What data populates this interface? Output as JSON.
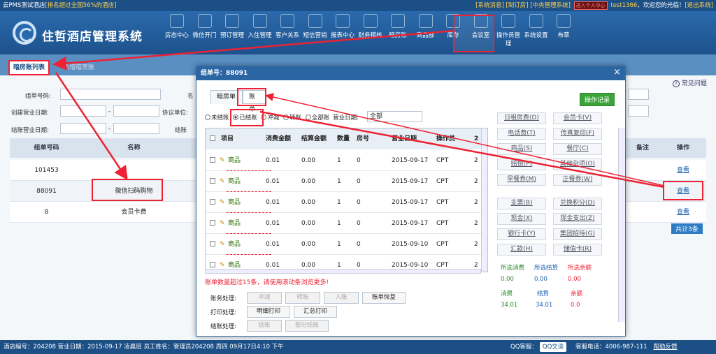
{
  "topbar": {
    "left_name": "云PMS测试酒店",
    "left_rank": "[排名超过全国56%的酒店]",
    "links": "[系统消息] [制订房] [中央管理系统]",
    "badge": "进入个人中心",
    "user": "test1366",
    "greeting": "，欢迎您的光临！",
    "logout": "[退出系统]"
  },
  "brand": {
    "name": "住哲酒店管理系统"
  },
  "nav": [
    {
      "label": "房态中心",
      "icon": "home-icon"
    },
    {
      "label": "微信开门",
      "icon": "door-icon"
    },
    {
      "label": "预订管理",
      "icon": "booking-icon"
    },
    {
      "label": "入住管理",
      "icon": "checkin-icon"
    },
    {
      "label": "客户关系",
      "icon": "customers-icon"
    },
    {
      "label": "短信营销",
      "icon": "sms-icon"
    },
    {
      "label": "报表中心",
      "icon": "report-icon"
    },
    {
      "label": "财务稽核",
      "icon": "finance-icon"
    },
    {
      "label": "暗房账",
      "icon": "ledger-icon"
    },
    {
      "label": "商品部",
      "icon": "goods-icon"
    },
    {
      "label": "库存",
      "icon": "stock-icon"
    },
    {
      "label": "会议室",
      "icon": "meeting-icon"
    },
    {
      "label": "操作员管理",
      "icon": "operator-icon"
    },
    {
      "label": "系统设置",
      "icon": "settings-icon"
    },
    {
      "label": "布草",
      "icon": "linen-icon"
    }
  ],
  "page_tabs": {
    "active": "暗房账列表",
    "other": "新增暗房账"
  },
  "help": "常见问题",
  "filters": {
    "group_no": "组单号码:",
    "create_date": "创建营业日期:",
    "settle_date": "结账营业日期:",
    "unit": "协议单位:",
    "name_short": "名",
    "settle_short": "结账"
  },
  "grid": {
    "headers": [
      "组单号码",
      "名称",
      "备注",
      "操作"
    ],
    "rows": [
      {
        "no": "101453",
        "name": "",
        "action": "查看"
      },
      {
        "no": "88091",
        "name": "微信扫码购物",
        "action": "查看"
      },
      {
        "no": "8",
        "name": "会员卡费",
        "action": "查看"
      }
    ],
    "total": "共计3条"
  },
  "modal": {
    "title": "组单号：88091",
    "close": "×",
    "tabs": [
      "暗房单",
      "账单"
    ],
    "op_record": "操作记录",
    "radios": [
      "未结账",
      "已结账",
      "冲减",
      "转账",
      "全部账"
    ],
    "date_label": "营业日期:",
    "select_value": "全部",
    "headers": [
      "",
      "项目",
      "消费金额",
      "结算金额",
      "数量",
      "房号",
      "营业日期",
      "操作员",
      "2"
    ],
    "rows": [
      {
        "item": "商品",
        "amount": "0.01",
        "settle": "0.00",
        "qty": "1",
        "room": "0",
        "date": "2015-09-17",
        "op": "CPT",
        "more": "2"
      },
      {
        "item": "商品",
        "amount": "0.01",
        "settle": "0.00",
        "qty": "1",
        "room": "0",
        "date": "2015-09-17",
        "op": "CPT",
        "more": "2"
      },
      {
        "item": "商品",
        "amount": "0.01",
        "settle": "0.00",
        "qty": "1",
        "room": "0",
        "date": "2015-09-17",
        "op": "CPT",
        "more": "2"
      },
      {
        "item": "商品",
        "amount": "0.01",
        "settle": "0.00",
        "qty": "1",
        "room": "0",
        "date": "2015-09-17",
        "op": "CPT",
        "more": "2"
      },
      {
        "item": "商品",
        "amount": "0.01",
        "settle": "0.00",
        "qty": "1",
        "room": "0",
        "date": "2015-09-10",
        "op": "CPT",
        "more": "2"
      },
      {
        "item": "商品",
        "amount": "0.01",
        "settle": "0.00",
        "qty": "1",
        "room": "0",
        "date": "2015-09-10",
        "op": "CPT",
        "more": "2"
      }
    ],
    "warning": "账单数量超过15条，请使用滚动条浏览更多!",
    "actions": [
      {
        "label": "账务处理:",
        "buttons": [
          {
            "t": "冲减",
            "dis": true
          },
          {
            "t": "转账",
            "dis": true
          },
          {
            "t": "入账",
            "dis": true
          },
          {
            "t": "账单恢复",
            "dis": false
          }
        ]
      },
      {
        "label": "打印处理:",
        "buttons": [
          {
            "t": "明细打印",
            "dis": false
          },
          {
            "t": "汇总打印",
            "dis": false
          }
        ]
      },
      {
        "label": "结账处理:",
        "buttons": [
          {
            "t": "结账",
            "dis": true
          },
          {
            "t": "部分结账",
            "dis": true
          }
        ]
      }
    ],
    "side_buttons": [
      "日租房费(D)",
      "会员卡(V)",
      "电话费(T)",
      "传真复印(F)",
      "商品(S)",
      "餐厅(C)",
      "赔偿(P)",
      "其他杂项(O)",
      "早餐券(M)",
      "正餐券(W)",
      "支票(B)",
      "兑换积分(D)",
      "现金(X)",
      "现金支出(Z)",
      "银行卡(Y)",
      "集团招待(G)",
      "汇款(H)",
      "储值卡(R)"
    ],
    "sums": {
      "sel_consume": "所选消费",
      "sel_settle": "所选结算",
      "sel_balance": "所选余额",
      "v1": "0.00",
      "v2": "0.00",
      "v3": "0.00",
      "consume": "消费",
      "settle": "结算",
      "balance": "余额",
      "c": "34.01",
      "s": "34.01",
      "b": "0.0"
    }
  },
  "status": {
    "left": "酒店编号：204208  营业日期：2015-09-17  凌晨班  员工姓名：管理员204208 周四 09月17日4:10 下午",
    "qq_label": "QQ客服：",
    "qq_btn": "QQ交谈",
    "phone": "客服电话：4006-987-111",
    "feedback": "帮助反馈"
  },
  "colors": {
    "header": "#1b4f86",
    "highlight": "#e23",
    "link": "#1a5fb0",
    "green": "#3aa33a"
  }
}
